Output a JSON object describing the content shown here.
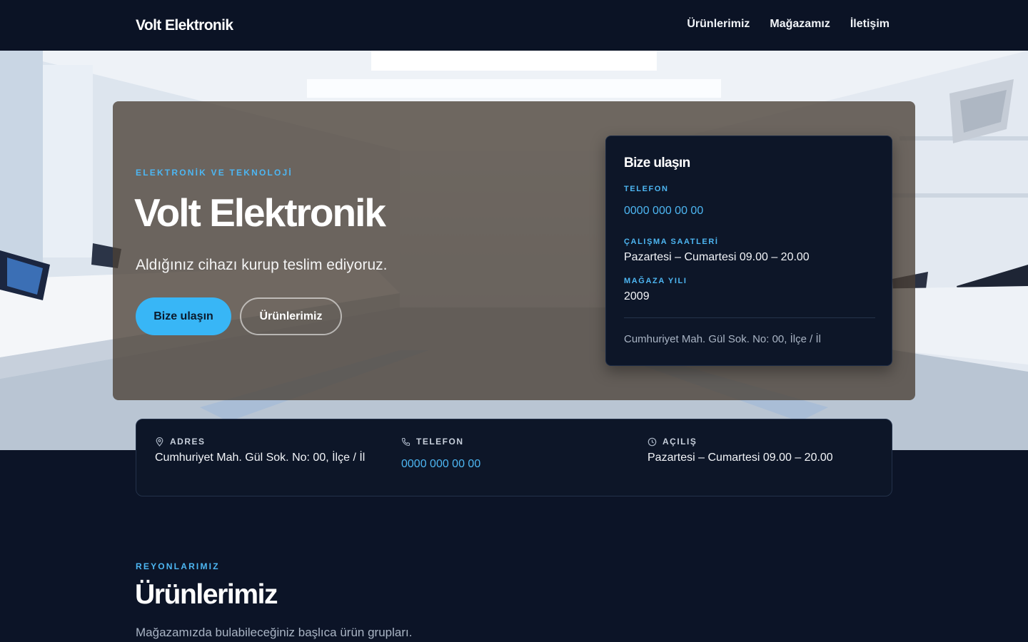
{
  "nav": {
    "brand": "Volt Elektronik",
    "links": [
      "Ürünlerimiz",
      "Mağazamız",
      "İletişim"
    ]
  },
  "hero": {
    "eyebrow": "ELEKTRONİK VE TEKNOLOJİ",
    "title": "Volt Elektronik",
    "subtitle": "Aldığınız cihazı kurup teslim ediyoruz.",
    "primary_button": "Bize ulaşın",
    "secondary_button": "Ürünlerimiz"
  },
  "contact_card": {
    "title": "Bize ulaşın",
    "phone_label": "TELEFON",
    "phone": "0000 000 00 00",
    "hours_label": "ÇALIŞMA SAATLERİ",
    "hours": "Pazartesi – Cumartesi 09.00 – 20.00",
    "year_label": "MAĞAZA YILI",
    "year": "2009",
    "address": "Cumhuriyet Mah. Gül Sok. No: 00, İlçe / İl"
  },
  "info_strip": {
    "address_label": "ADRES",
    "address": "Cumhuriyet Mah. Gül Sok. No: 00, İlçe / İl",
    "phone_label": "TELEFON",
    "phone": "0000 000 00 00",
    "hours_label": "AÇILIŞ",
    "hours": "Pazartesi – Cumartesi 09.00 – 20.00"
  },
  "products": {
    "eyebrow": "REYONLARIMIZ",
    "title": "Ürünlerimiz",
    "subtitle": "Mağazamızda bulabileceğiniz başlıca ürün grupları."
  },
  "colors": {
    "accent": "#38b6f6",
    "accent_text": "#4db6f2",
    "background": "#0c1427",
    "card": "#0d1628"
  },
  "icons": {
    "address": "map-pin-icon",
    "phone": "phone-icon",
    "hours": "clock-icon"
  }
}
